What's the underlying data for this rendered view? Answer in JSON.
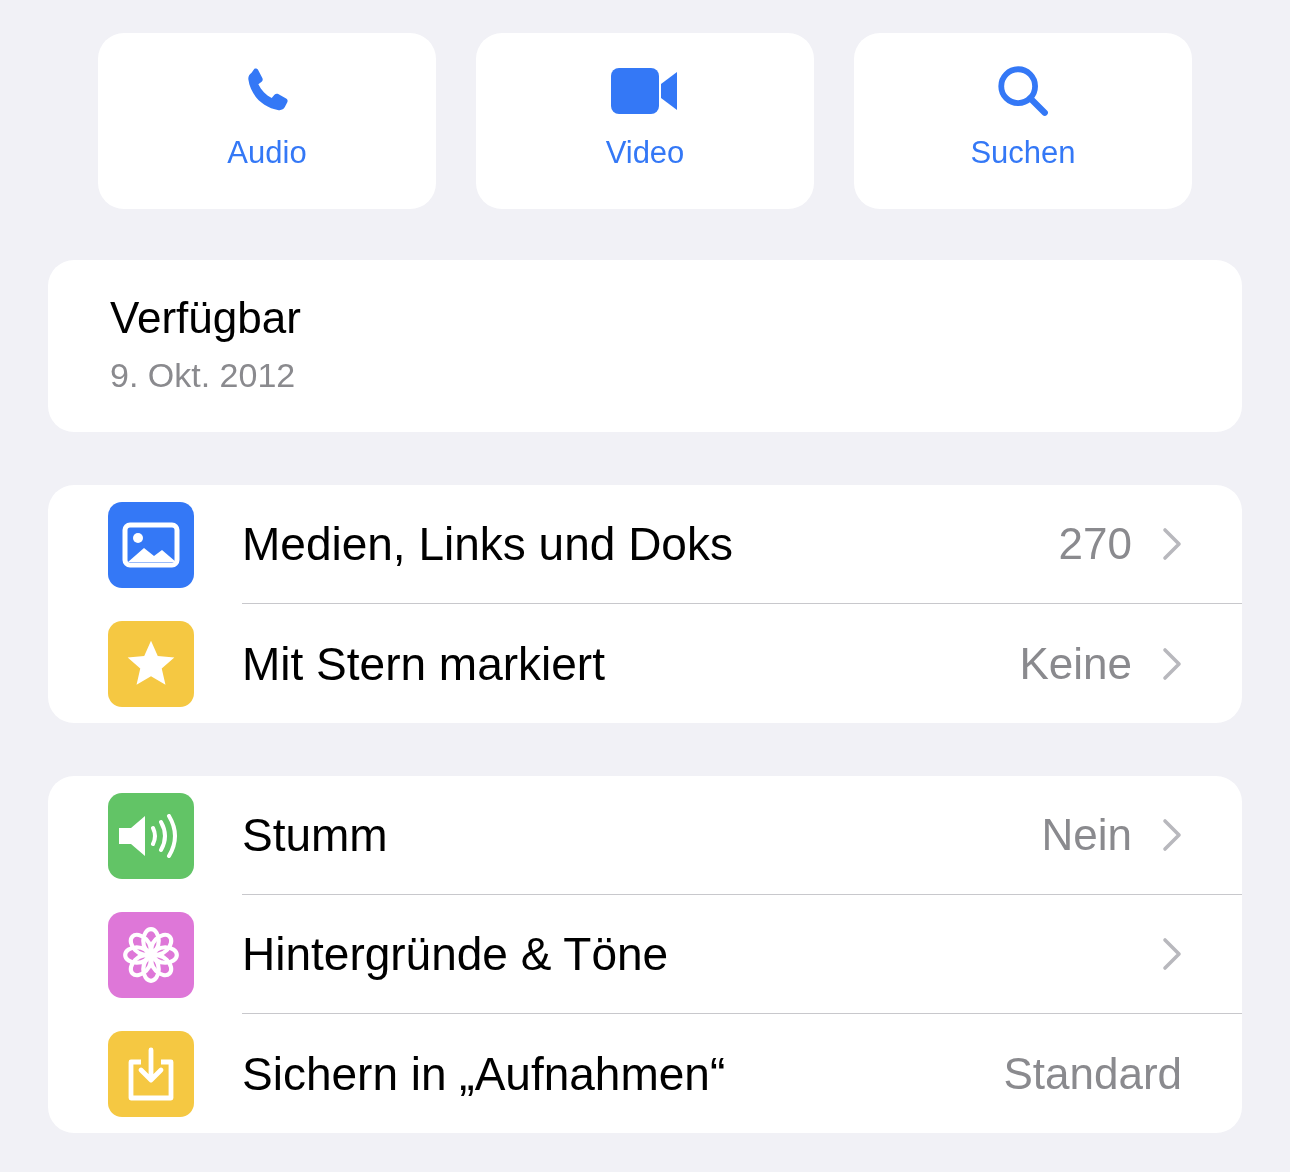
{
  "actions": [
    {
      "kind": "phone",
      "label": "Audio"
    },
    {
      "kind": "video",
      "label": "Video"
    },
    {
      "kind": "search",
      "label": "Suchen"
    }
  ],
  "status": {
    "text": "Verfügbar",
    "date": "9. Okt. 2012"
  },
  "groups": [
    {
      "rows": [
        {
          "kind": "media",
          "color": "#3478f6",
          "label": "Medien, Links und Doks",
          "value": "270",
          "chevron": true
        },
        {
          "kind": "star",
          "color": "#f5c842",
          "label": "Mit Stern markiert",
          "value": "Keine",
          "chevron": true
        }
      ]
    },
    {
      "rows": [
        {
          "kind": "speaker",
          "color": "#62c466",
          "label": "Stumm",
          "value": "Nein",
          "chevron": true
        },
        {
          "kind": "flower",
          "color": "#de77d8",
          "label": "Hintergründe & Töne",
          "chevron": true
        },
        {
          "kind": "save",
          "color": "#f5c842",
          "label": "Sichern in „Aufnahmen“",
          "value": "Standard",
          "chevron": false
        }
      ]
    }
  ]
}
